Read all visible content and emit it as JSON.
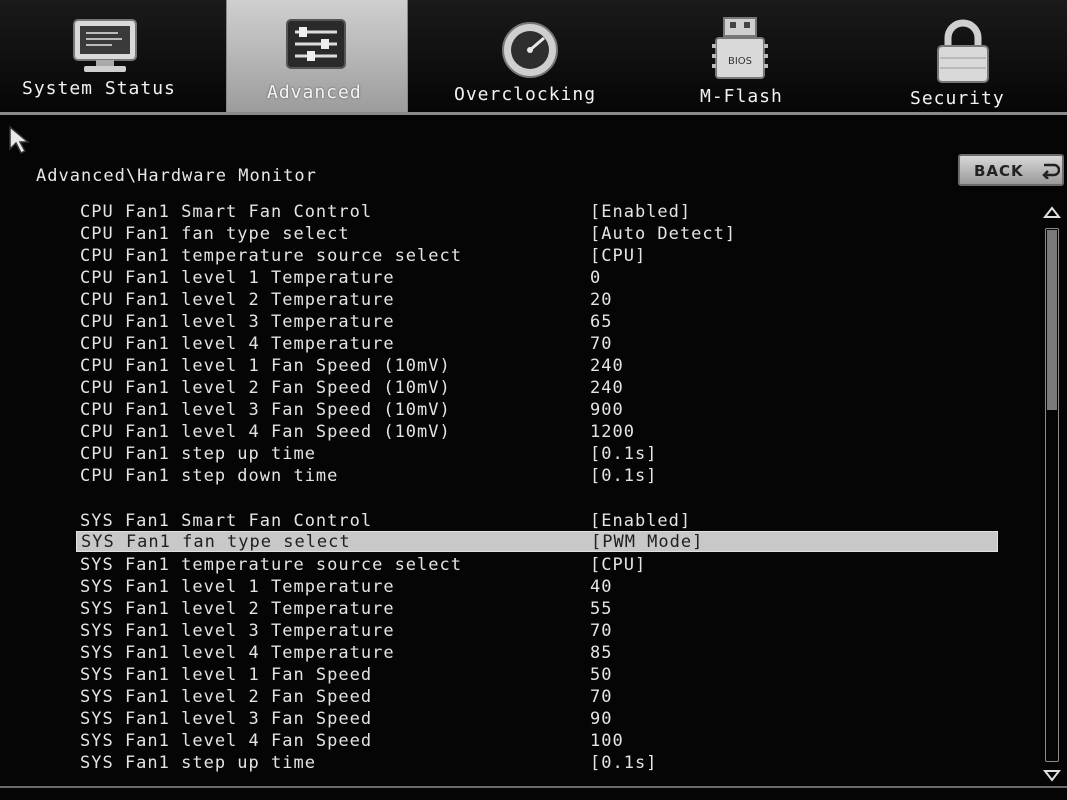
{
  "tabs": [
    {
      "label": "System Status",
      "icon": "monitor-icon",
      "active": false
    },
    {
      "label": "Advanced",
      "icon": "settings-panel-icon",
      "active": true
    },
    {
      "label": "Overclocking",
      "icon": "speedometer-icon",
      "active": false
    },
    {
      "label": "M-Flash",
      "icon": "bios-chip-icon",
      "active": false
    },
    {
      "label": "Security",
      "icon": "lock-icon",
      "active": false
    }
  ],
  "bios_chip_text": "BIOS",
  "breadcrumb": "Advanced\\Hardware Monitor",
  "back_label": "BACK",
  "settings": [
    {
      "label": "CPU Fan1 Smart Fan Control",
      "value": "[Enabled]"
    },
    {
      "label": "CPU Fan1 fan type select",
      "value": "[Auto Detect]"
    },
    {
      "label": "CPU Fan1 temperature source select",
      "value": "[CPU]"
    },
    {
      "label": "CPU Fan1 level 1 Temperature",
      "value": "0"
    },
    {
      "label": "CPU Fan1 level 2 Temperature",
      "value": "20"
    },
    {
      "label": "CPU Fan1 level 3 Temperature",
      "value": "65"
    },
    {
      "label": "CPU Fan1 level 4 Temperature",
      "value": "70"
    },
    {
      "label": "CPU Fan1 level 1 Fan Speed (10mV)",
      "value": "240"
    },
    {
      "label": "CPU Fan1 level 2 Fan Speed (10mV)",
      "value": "240"
    },
    {
      "label": "CPU Fan1 level 3 Fan Speed (10mV)",
      "value": "900"
    },
    {
      "label": "CPU Fan1 level 4 Fan Speed (10mV)",
      "value": "1200"
    },
    {
      "label": "CPU Fan1 step up time",
      "value": "[0.1s]"
    },
    {
      "label": "CPU Fan1 step down time",
      "value": "[0.1s]"
    },
    {
      "label": "SYS Fan1 Smart Fan Control",
      "value": "[Enabled]"
    },
    {
      "label": "SYS Fan1 fan type select",
      "value": "[PWM Mode]",
      "selected": true
    },
    {
      "label": "SYS Fan1 temperature source select",
      "value": "[CPU]"
    },
    {
      "label": "SYS Fan1 level 1 Temperature",
      "value": "40"
    },
    {
      "label": "SYS Fan1 level 2 Temperature",
      "value": "55"
    },
    {
      "label": "SYS Fan1 level 3 Temperature",
      "value": "70"
    },
    {
      "label": "SYS Fan1 level 4 Temperature",
      "value": "85"
    },
    {
      "label": "SYS Fan1 level 1 Fan Speed",
      "value": "50"
    },
    {
      "label": "SYS Fan1 level 2 Fan Speed",
      "value": "70"
    },
    {
      "label": "SYS Fan1 level 3 Fan Speed",
      "value": "90"
    },
    {
      "label": "SYS Fan1 level 4 Fan Speed",
      "value": "100"
    },
    {
      "label": "SYS Fan1 step up time",
      "value": "[0.1s]"
    }
  ],
  "scrollbar": {
    "position": 0.0,
    "visible_fraction": 0.34
  }
}
